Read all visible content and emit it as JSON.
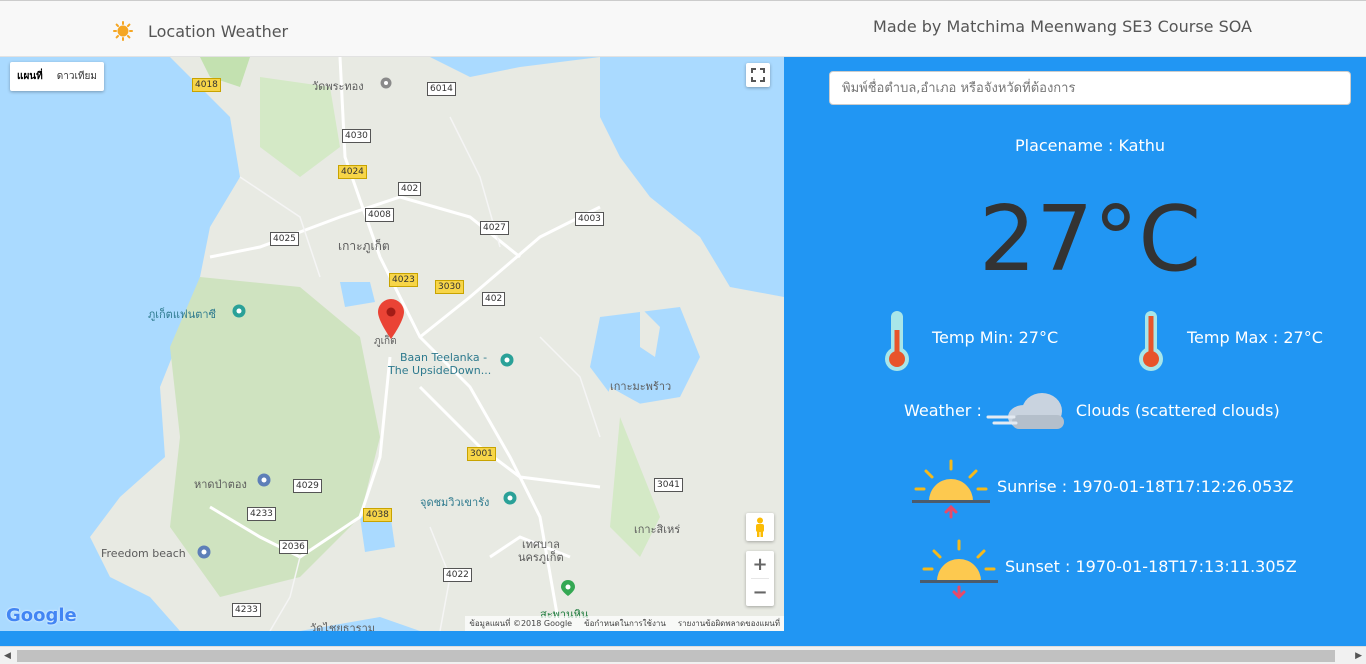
{
  "header": {
    "brand_icon": "sun-icon",
    "brand_text": "Location Weather",
    "credit": "Made by Matchima Meenwang SE3 Course SOA"
  },
  "map": {
    "map_type_options": [
      "แผนที่",
      "ดาวเทียม"
    ],
    "selected_map_type": "แผนที่",
    "labels": {
      "wat_phra_thong": "วัดพระทอง",
      "koh_phuket": "เกาะภูเก็ต",
      "phuket_fantasea": "ภูเก็ตแฟนตาซี",
      "phuket": "ภูเก็ต",
      "baan_teelanka_1": "Baan Teelanka -",
      "baan_teelanka_2": "The UpsideDown...",
      "koh_maphrao": "เกาะมะพร้าว",
      "patong_beach": "หาดป่าตอง",
      "viewpoint": "จุดชมวิวเขารัง",
      "freedom_beach": "Freedom beach",
      "koh_sire": "เกาะสิเหร่",
      "municipality_1": "เทศบาล",
      "municipality_2": "นครภูเก็ต",
      "saphan_hin": "สะพานหิน",
      "wat_bottom": "วัดไชยธาราม"
    },
    "road_shields": [
      "4018",
      "6014",
      "4030",
      "4024",
      "402",
      "4008",
      "4027",
      "4003",
      "4025",
      "4023",
      "3030",
      "402",
      "3001",
      "4029",
      "3041",
      "4233",
      "4038",
      "2036",
      "4022",
      "4233"
    ],
    "google_logo": "Google",
    "attribution": [
      "ข้อมูลแผนที่ ©2018 Google",
      "ข้อกำหนดในการใช้งาน",
      "รายงานข้อผิดพลาดของแผนที่"
    ],
    "zoom_in": "+",
    "zoom_out": "−"
  },
  "panel": {
    "search_placeholder": "พิมพ์ชื่อตำบล,อำเภอ หรือจังหวัดที่ต้องการ",
    "placename": "Placename : Kathu",
    "temperature": "27°C",
    "temp_min": "Temp Min: 27°C",
    "temp_max": "Temp Max : 27°C",
    "weather_label": "Weather :",
    "weather_value": "Clouds (scattered clouds)",
    "sunrise": "Sunrise : 1970-01-18T17:12:26.053Z",
    "sunset": "Sunset : 1970-01-18T17:13:11.305Z"
  },
  "colors": {
    "accent": "#2196f3",
    "water": "#aadaff",
    "land": "#e8eae3",
    "marker": "#ea4335"
  }
}
